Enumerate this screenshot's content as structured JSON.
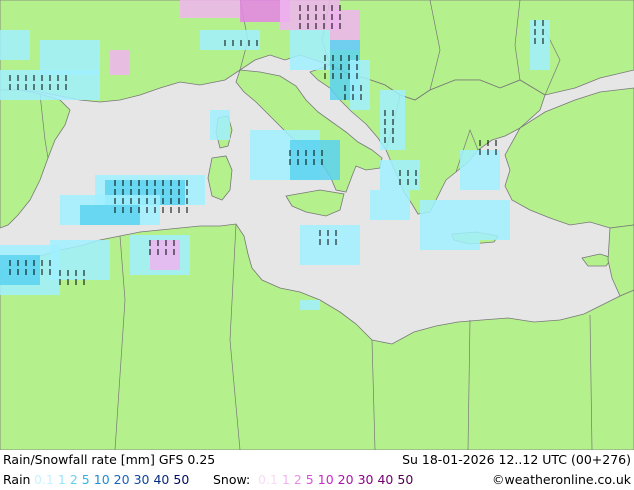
{
  "title": "Rain/Snowfall rate [mm] GFS 0.25",
  "datetime": "Su 18-01-2026 12..12 UTC (00+276)",
  "legend": {
    "rain_label": "Rain",
    "rain_values": [
      "0.1",
      "1",
      "2",
      "5",
      "10",
      "20",
      "30",
      "40",
      "50"
    ],
    "rain_colors": [
      "#c8f0ff",
      "#96e6fa",
      "#64d2f5",
      "#32b4eb",
      "#1e8cd7",
      "#1464be",
      "#0a46a0",
      "#06287d",
      "#000a5a"
    ],
    "snow_label": "Snow:",
    "snow_values": [
      "0.1",
      "1",
      "2",
      "5",
      "10",
      "20",
      "30",
      "40",
      "50"
    ],
    "snow_colors": [
      "#f5dcf5",
      "#f0b4f0",
      "#eb8ceb",
      "#dc50dc",
      "#c828c8",
      "#aa14aa",
      "#8c008c",
      "#6e006e",
      "#500050"
    ]
  },
  "credit": "©weatheronline.co.uk",
  "colors": {
    "land": "#b4f08c",
    "sea": "#e6e6e6",
    "border": "#787878",
    "rain_light": "#a0f0ff",
    "rain_medium": "#5ad2f0",
    "snow_light": "#f0b4f0",
    "snow_medium": "#e682e6",
    "symbol": "#000000"
  },
  "icons": {
    "precip_symbol": "tick-mark-icon"
  }
}
